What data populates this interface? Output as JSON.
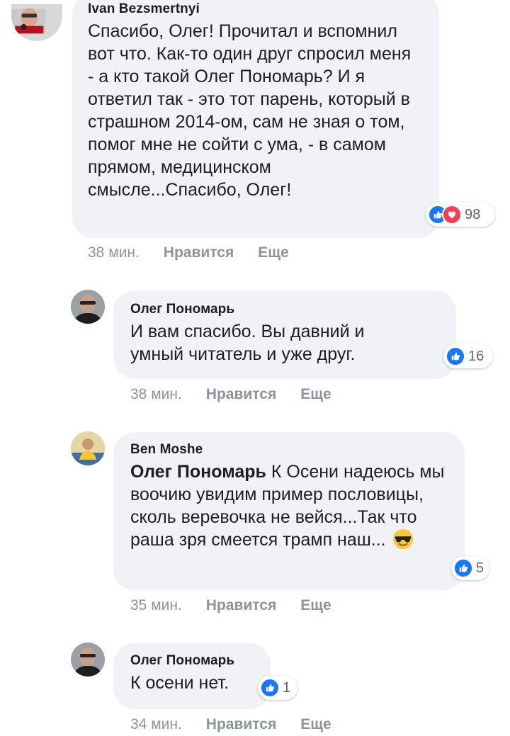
{
  "comments": [
    {
      "author": "Ivan Bezsmertnyi",
      "text": "Спасибо, Олег! Прочитал и вспомнил вот что. Как-то один друг спросил меня - а кто такой Олег Пономарь? И я ответил так - это тот парень, который в страшном 2014-ом, сам не зная о том, помог мне не сойти с ума, - в самом прямом, медицинском смысле...Спасибо, Олег!",
      "reaction_count": "98",
      "reactions": [
        "like-icon",
        "love-icon"
      ],
      "time": "38 мин.",
      "like_label": "Нравится",
      "more_label": "Еще"
    },
    {
      "author": "Олег Пономарь",
      "text": "И вам спасибо. Вы давний и умный читатель и уже друг.",
      "reaction_count": "16",
      "reactions": [
        "like-icon"
      ],
      "time": "38 мин.",
      "like_label": "Нравится",
      "more_label": "Еще"
    },
    {
      "author": "Ben Moshe",
      "mention": "Олег Пономарь",
      "text": "К Осени надеюсь мы воочию увидим пример пословицы, сколь веревочка не вейся...Так что раша зря смеется трамп наш...",
      "emoji": "sunglasses-emoji",
      "reaction_count": "5",
      "reactions": [
        "like-icon"
      ],
      "time": "35 мин.",
      "like_label": "Нравится",
      "more_label": "Еще"
    },
    {
      "author": "Олег Пономарь",
      "text": "К осени нет.",
      "reaction_count": "1",
      "reactions": [
        "like-icon"
      ],
      "time": "34 мин.",
      "like_label": "Нравится",
      "more_label": "Еще"
    }
  ],
  "colors": {
    "bubble": "#f0f2f5",
    "like": "#1877f2",
    "love": "#f33e58",
    "meta": "#8d949e"
  }
}
